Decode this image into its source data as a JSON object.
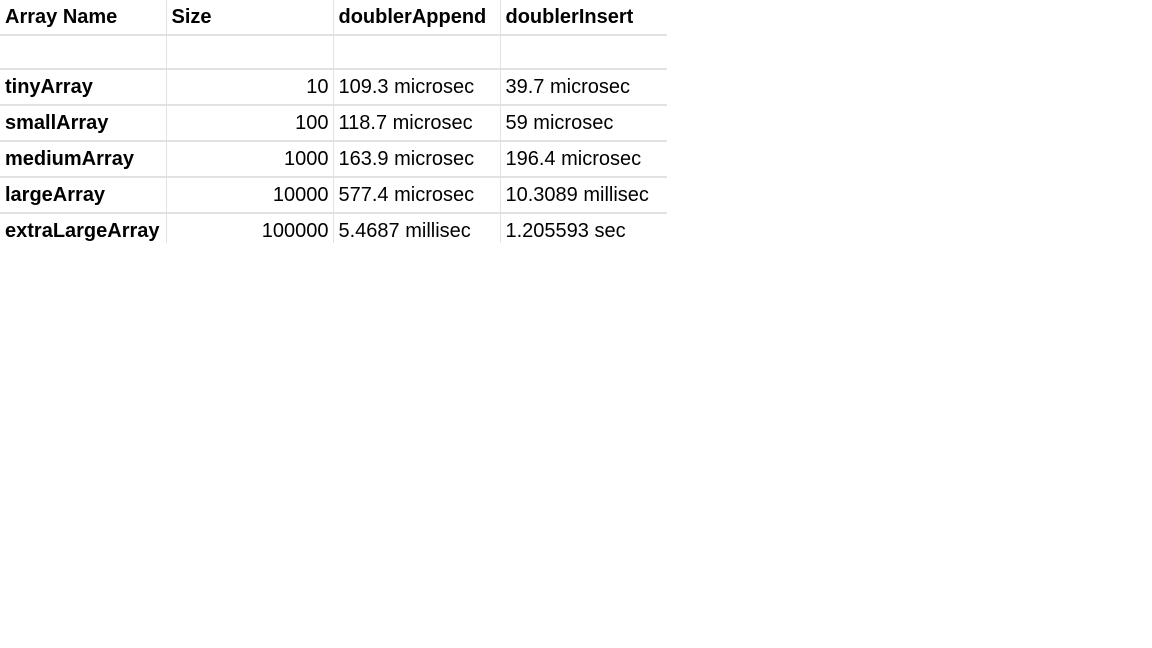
{
  "columns": [
    "Array Name",
    "Size",
    "doublerAppend",
    "doublerInsert"
  ],
  "rows": [
    {
      "name": "tinyArray",
      "size": "10",
      "append": "109.3 microsec",
      "insert": "39.7 microsec"
    },
    {
      "name": "smallArray",
      "size": "100",
      "append": "118.7 microsec",
      "insert": "59 microsec"
    },
    {
      "name": "mediumArray",
      "size": "1000",
      "append": "163.9 microsec",
      "insert": "196.4 microsec"
    },
    {
      "name": "largeArray",
      "size": "10000",
      "append": "577.4 microsec",
      "insert": "10.3089 millisec"
    },
    {
      "name": "extraLargeArray",
      "size": "100000",
      "append": "5.4687 millisec",
      "insert": "1.205593 sec"
    }
  ]
}
